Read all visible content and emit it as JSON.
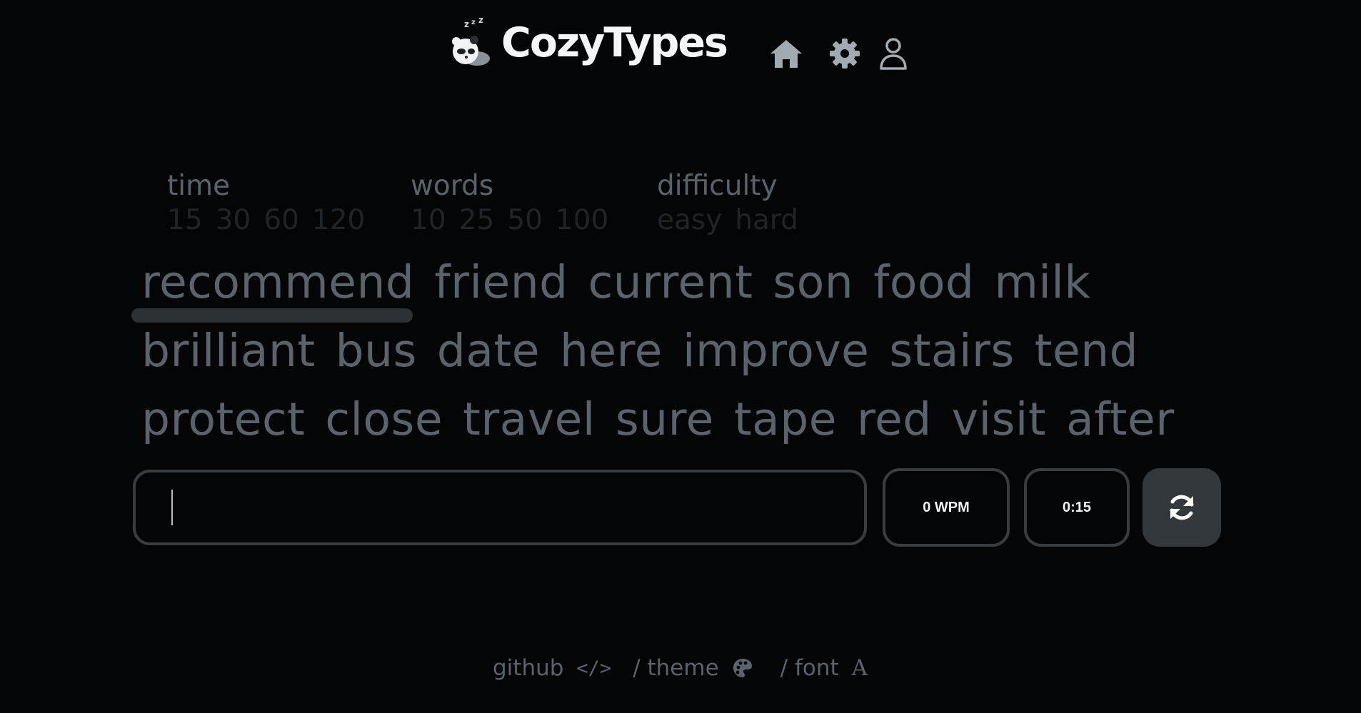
{
  "header": {
    "brand": "CozyTypes",
    "icons": [
      "home-icon",
      "gear-icon",
      "user-icon"
    ]
  },
  "options": {
    "time": {
      "label": "time",
      "values": [
        "15",
        "30",
        "60",
        "120"
      ]
    },
    "words": {
      "label": "words",
      "values": [
        "10",
        "25",
        "50",
        "100"
      ]
    },
    "difficulty": {
      "label": "difficulty",
      "values": [
        "easy",
        "hard"
      ]
    }
  },
  "words": {
    "lines": [
      [
        "recommend",
        "friend",
        "current",
        "son",
        "food",
        "milk"
      ],
      [
        "brilliant",
        "bus",
        "date",
        "here",
        "improve",
        "stairs",
        "tend"
      ],
      [
        "protect",
        "close",
        "travel",
        "sure",
        "tape",
        "red",
        "visit",
        "after"
      ]
    ],
    "active_word": "recommend"
  },
  "input": {
    "value": ""
  },
  "stats": {
    "wpm": "0 WPM",
    "timer": "0:15"
  },
  "footer": {
    "github": "github",
    "theme": "/ theme",
    "font": "/ font",
    "code_glyph": "</>",
    "font_glyph": "A"
  },
  "colors": {
    "background": "#040506",
    "text_muted": "#5a636c",
    "text_dim": "#1f2428",
    "border": "#383d42",
    "button": "#33383d",
    "brand": "#f4f6f8"
  }
}
